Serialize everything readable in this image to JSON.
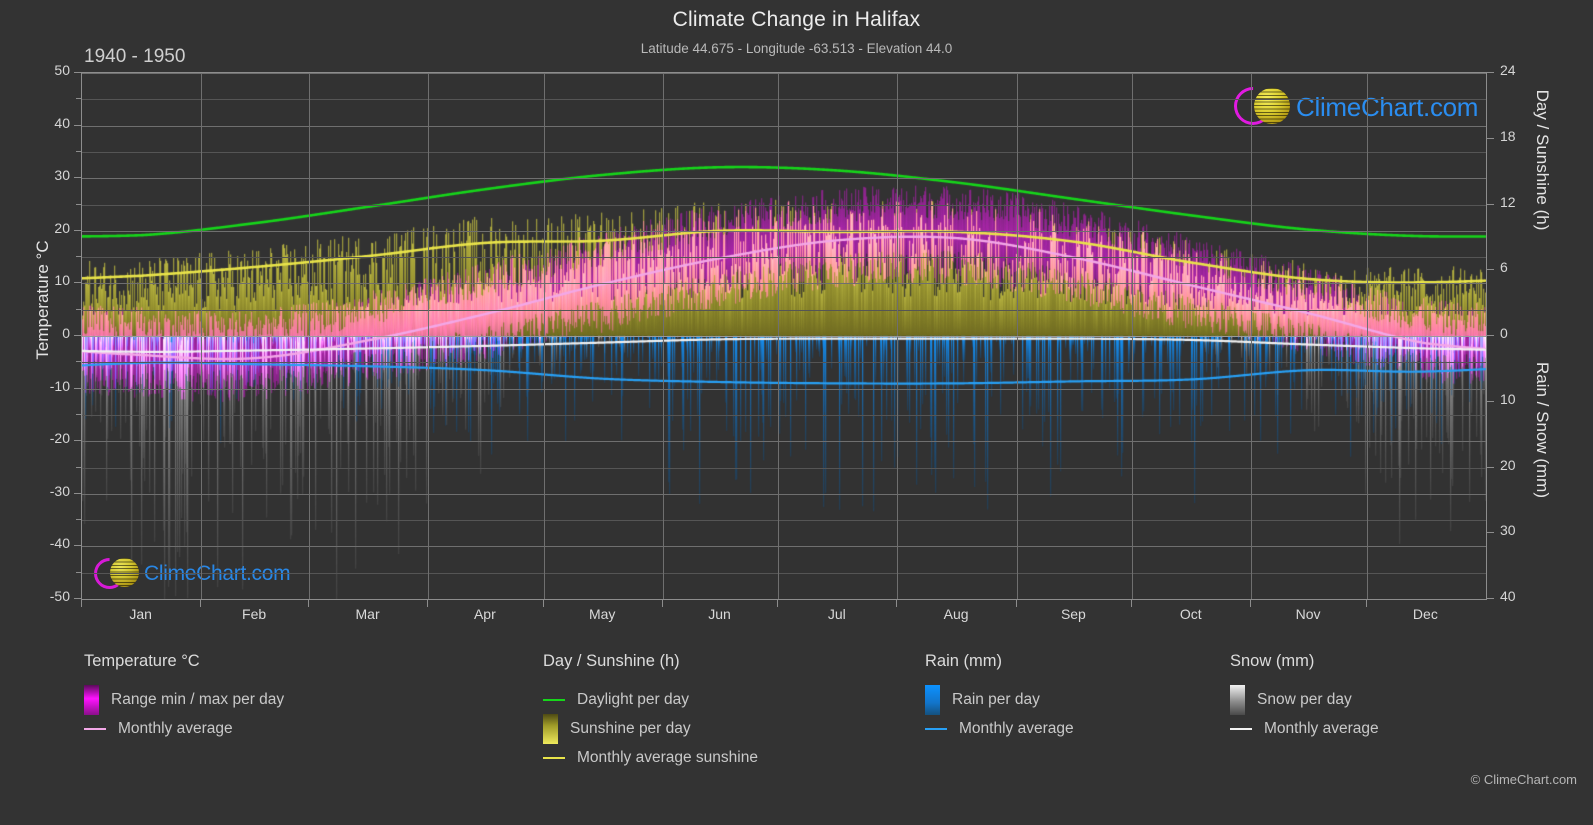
{
  "header": {
    "title": "Climate Change in Halifax",
    "subtitle": "Latitude 44.675 - Longitude -63.513 - Elevation 44.0",
    "period": "1940 - 1950"
  },
  "watermark": {
    "text": "ClimeChart.com"
  },
  "copyright": "© ClimeChart.com",
  "axes": {
    "left_title": "Temperature °C",
    "right_title_top": "Day / Sunshine (h)",
    "right_title_bottom": "Rain / Snow (mm)",
    "left_ticks": [
      "50",
      "40",
      "30",
      "20",
      "10",
      "0",
      "-10",
      "-20",
      "-30",
      "-40",
      "-50"
    ],
    "right_ticks_top": [
      "24",
      "18",
      "12",
      "6",
      "0"
    ],
    "right_ticks_bottom": [
      "0",
      "10",
      "20",
      "30",
      "40"
    ],
    "x_ticks": [
      "Jan",
      "Feb",
      "Mar",
      "Apr",
      "May",
      "Jun",
      "Jul",
      "Aug",
      "Sep",
      "Oct",
      "Nov",
      "Dec"
    ]
  },
  "legend": {
    "temperature": {
      "heading": "Temperature °C",
      "items": [
        {
          "label": "Range min / max per day",
          "swatch": "gradient",
          "color": "#ee11ee"
        },
        {
          "label": "Monthly average",
          "swatch": "line",
          "color": "#f3a8e8"
        }
      ]
    },
    "daysun": {
      "heading": "Day / Sunshine (h)",
      "items": [
        {
          "label": "Daylight per day",
          "swatch": "line",
          "color": "#16d61a"
        },
        {
          "label": "Sunshine per day",
          "swatch": "gradient",
          "color": "#e9e44a"
        },
        {
          "label": "Monthly average sunshine",
          "swatch": "line",
          "color": "#e9e44a"
        }
      ]
    },
    "rain": {
      "heading": "Rain (mm)",
      "items": [
        {
          "label": "Rain per day",
          "swatch": "gradient",
          "color": "#1b8ef0"
        },
        {
          "label": "Monthly average",
          "swatch": "line",
          "color": "#28a0f5"
        }
      ]
    },
    "snow": {
      "heading": "Snow (mm)",
      "items": [
        {
          "label": "Snow per day",
          "swatch": "gradient",
          "color": "#dddddd"
        },
        {
          "label": "Monthly average",
          "swatch": "line",
          "color": "#f2f2f2"
        }
      ]
    }
  },
  "chart_data": {
    "type": "line",
    "title": "Climate Change in Halifax",
    "subtitle": "Latitude 44.675 - Longitude -63.513 - Elevation 44.0",
    "period": "1940 - 1950",
    "xlabel": "",
    "ylabel": "Temperature °C",
    "ylim": [
      -50,
      50
    ],
    "y2lim_day_sunshine_h": [
      0,
      24
    ],
    "y2lim_rain_snow_mm": [
      0,
      40
    ],
    "grid": true,
    "legend_position": "below",
    "categories": [
      "Jan",
      "Feb",
      "Mar",
      "Apr",
      "May",
      "Jun",
      "Jul",
      "Aug",
      "Sep",
      "Oct",
      "Nov",
      "Dec"
    ],
    "series": [
      {
        "name": "Daylight per day",
        "unit": "h",
        "axis": "right-top",
        "color": "#16d61a",
        "values": [
          9.2,
          10.3,
          11.8,
          13.4,
          14.7,
          15.4,
          15.1,
          14.0,
          12.5,
          11.0,
          9.7,
          9.1
        ]
      },
      {
        "name": "Monthly average sunshine",
        "unit": "h",
        "axis": "right-top",
        "color": "#e9e44a",
        "values": [
          5.5,
          6.3,
          7.3,
          8.5,
          8.7,
          9.6,
          9.5,
          9.5,
          8.6,
          6.7,
          5.2,
          4.9
        ]
      },
      {
        "name": "Monthly average temperature",
        "unit": "°C",
        "axis": "left",
        "color": "#f3a8e8",
        "values": [
          -3.6,
          -4.2,
          -0.8,
          4.2,
          9.9,
          14.8,
          18.2,
          18.6,
          14.9,
          9.6,
          4.3,
          -1.4
        ]
      },
      {
        "name": "Monthly average rain",
        "unit": "mm",
        "axis": "right-bottom",
        "color": "#28a0f5",
        "values": [
          4.1,
          4.3,
          4.6,
          5.2,
          6.5,
          7.0,
          7.2,
          7.2,
          6.9,
          6.6,
          5.2,
          5.4
        ]
      },
      {
        "name": "Monthly average snow",
        "unit": "mm",
        "axis": "right-bottom",
        "color": "#f2f2f2",
        "values": [
          2.4,
          2.2,
          1.9,
          1.5,
          1.0,
          0.5,
          0.4,
          0.4,
          0.4,
          0.6,
          1.3,
          1.9
        ]
      }
    ],
    "daily_bands": [
      {
        "name": "Range min / max per day",
        "unit": "°C",
        "axis": "left",
        "color": "#ee11ee",
        "max_by_month": [
          2.0,
          1.5,
          5.0,
          10.5,
          16.5,
          21.5,
          24.5,
          25.0,
          21.5,
          15.5,
          9.5,
          3.5
        ],
        "min_by_month": [
          -9.0,
          -9.5,
          -6.0,
          -1.5,
          3.5,
          8.5,
          12.0,
          12.5,
          9.0,
          4.0,
          -0.5,
          -6.0
        ]
      },
      {
        "name": "Sunshine per day",
        "unit": "h",
        "axis": "right-top",
        "color": "#e9e44a",
        "max_by_month": [
          9.0,
          10.0,
          11.5,
          13.0,
          14.4,
          15.1,
          14.8,
          13.7,
          12.2,
          10.7,
          9.4,
          8.8
        ]
      },
      {
        "name": "Rain per day",
        "unit": "mm",
        "axis": "right-bottom",
        "color": "#1b8ef0",
        "peak_by_month": [
          12,
          13,
          14,
          15,
          18,
          20,
          22,
          22,
          21,
          20,
          16,
          15
        ]
      },
      {
        "name": "Snow per day",
        "unit": "mm",
        "axis": "right-bottom",
        "color": "#dddddd",
        "peak_by_month": [
          38,
          40,
          34,
          18,
          4,
          0,
          0,
          0,
          0,
          3,
          14,
          30
        ]
      }
    ]
  }
}
